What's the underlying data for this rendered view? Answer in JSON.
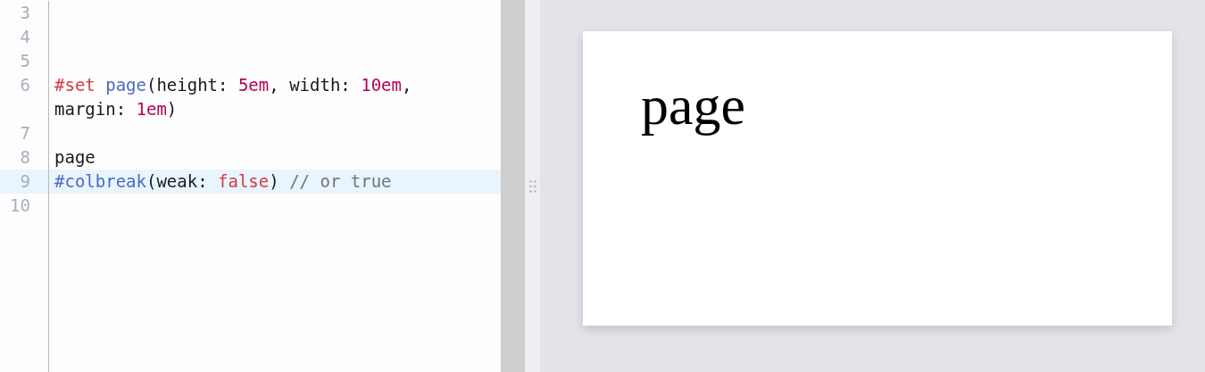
{
  "editor": {
    "lines": [
      {
        "number": "3",
        "current": false
      },
      {
        "number": "4",
        "current": false
      },
      {
        "number": "5",
        "current": false
      },
      {
        "number": "6",
        "current": false,
        "tokens": [
          {
            "kind": "keyword",
            "text": "#set"
          },
          {
            "kind": "function",
            "text": " page"
          },
          {
            "kind": "plain",
            "text": "(height: "
          },
          {
            "kind": "number",
            "text": "5em"
          },
          {
            "kind": "plain",
            "text": ", width: "
          },
          {
            "kind": "number",
            "text": "10em"
          },
          {
            "kind": "plain",
            "text": ", margin: "
          },
          {
            "kind": "number",
            "text": "1em"
          },
          {
            "kind": "plain",
            "text": ")"
          }
        ]
      },
      {
        "number": "7",
        "current": false
      },
      {
        "number": "8",
        "current": false,
        "tokens": [
          {
            "kind": "plain",
            "text": "page"
          }
        ]
      },
      {
        "number": "9",
        "current": true,
        "tokens": [
          {
            "kind": "function",
            "text": "#colbreak"
          },
          {
            "kind": "plain",
            "text": "(weak: "
          },
          {
            "kind": "bool",
            "text": "false"
          },
          {
            "kind": "plain",
            "text": ") "
          },
          {
            "kind": "comment",
            "text": "// or true"
          }
        ]
      },
      {
        "number": "10",
        "current": false
      }
    ]
  },
  "preview": {
    "page_text": "page"
  }
}
